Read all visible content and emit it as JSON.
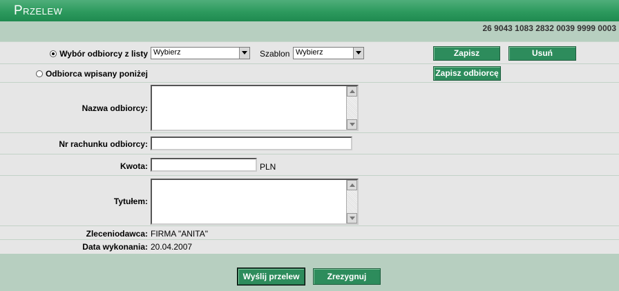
{
  "header": {
    "title": "Przelew"
  },
  "account_number": "26 9043 1083 2832 0039 9999 0003",
  "recipient_choice": {
    "from_list_label": "Wybór odbiorcy z listy",
    "from_list_selected": true,
    "recipient_select_value": "Wybierz",
    "template_label": "Szablon",
    "template_select_value": "Wybierz",
    "entered_below_label": "Odbiorca wpisany poniżej",
    "entered_below_selected": false
  },
  "buttons": {
    "save": "Zapisz",
    "delete": "Usuń",
    "save_recipient": "Zapisz odbiorcę",
    "send": "Wyślij przelew",
    "cancel": "Zrezygnuj"
  },
  "form": {
    "recipient_name_label": "Nazwa odbiorcy:",
    "recipient_name_value": "",
    "account_label": "Nr rachunku odbiorcy:",
    "account_value": "",
    "amount_label": "Kwota:",
    "amount_value": "",
    "currency": "PLN",
    "title_label": "Tytułem:",
    "title_value": "",
    "orderer_label": "Zleceniodawca:",
    "orderer_value": "FIRMA \"ANITA\"",
    "date_label": "Data wykonania:",
    "date_value": "20.04.2007"
  }
}
